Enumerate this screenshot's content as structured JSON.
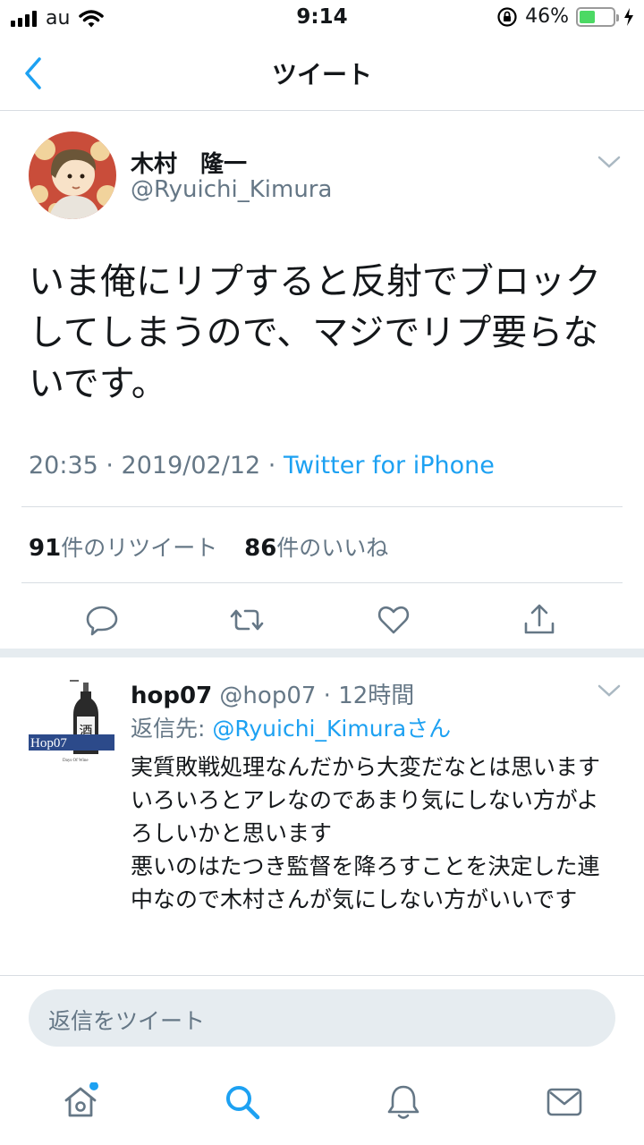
{
  "status_bar": {
    "carrier": "au",
    "time": "9:14",
    "battery_percent": "46%",
    "battery_level": 0.46,
    "icons": [
      "signal-icon",
      "wifi-icon",
      "rotation-lock-icon",
      "battery-icon",
      "charging-icon"
    ]
  },
  "nav": {
    "title": "ツイート"
  },
  "tweet": {
    "author_name": "木村　隆一",
    "author_handle": "@Ryuichi_Kimura",
    "text": "いま俺にリプすると反射でブロックしてしまうので、マジでリプ要らないです。",
    "time": "20:35 · 2019/02/12 · ",
    "source": "Twitter for iPhone",
    "retweet_count": "91",
    "retweet_label": "件のリツイート",
    "like_count": "86",
    "like_label": "件のいいね"
  },
  "reply": {
    "name": "hop07",
    "handle_time": " @hop07 · 12時間",
    "reply_to_prefix": "返信先: ",
    "reply_to_handle": "@Ryuichi_Kimuraさん",
    "avatar_text": "Hop07",
    "avatar_subtext": "Days Of Wine",
    "bottle_label": "酒",
    "text": "実質敗戦処理なんだから大変だなとは思います\nいろいろとアレなのであまり気にしない方がよろしいかと思います\n悪いのはたつき監督を降ろすことを決定した連中なので木村さんが気にしない方がいいです"
  },
  "compose": {
    "placeholder": "返信をツイート"
  },
  "colors": {
    "accent": "#1da1f2",
    "secondary_text": "#657786",
    "divider": "#e6ecf0",
    "battery_green": "#4cd964"
  }
}
